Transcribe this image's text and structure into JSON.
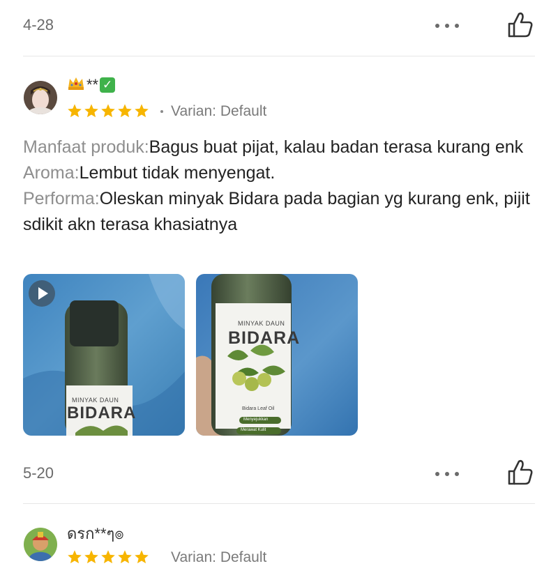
{
  "review1": {
    "date": "4-28",
    "username": "**",
    "rating": 5,
    "variant_label": "Varian: Default",
    "lines": [
      {
        "key": "Manfaat produk:",
        "value": "Bagus buat pijat, kalau badan terasa kurang enk"
      },
      {
        "key": "Aroma:",
        "value": "Lembut tidak menyengat."
      },
      {
        "key": "Performa:",
        "value": "Oleskan minyak Bidara pada bagian yg kurang enk, pijit sdikit akn terasa khasiatnya"
      }
    ],
    "media": [
      {
        "type": "video",
        "label_top": "MINYAK DAUN",
        "label_main": "BIDARA"
      },
      {
        "type": "photo",
        "label_top": "MINYAK DAUN",
        "label_main": "BIDARA",
        "label_sub": "Bidara Leaf Oil",
        "pill1": "Menyejukkan",
        "pill2": "Merawat Kulit"
      }
    ]
  },
  "review2": {
    "date": "5-20",
    "username": "ดรก**ๆ๏",
    "rating": 5,
    "variant_label": "Varian: Default"
  },
  "icons": {
    "more": "more-dots-icon",
    "like": "thumbs-up-icon",
    "star": "star-icon",
    "play": "play-icon",
    "verified": "verified-check-icon",
    "crown": "crown-icon"
  },
  "colors": {
    "star": "#f7b500",
    "key_text": "#8e8e8e",
    "verified": "#3fb24b"
  }
}
